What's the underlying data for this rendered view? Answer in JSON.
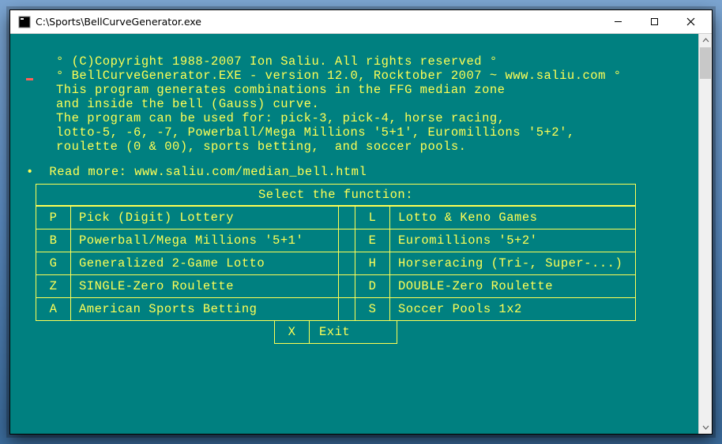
{
  "titlebar": {
    "path": "C:\\Sports\\BellCurveGenerator.exe"
  },
  "intro": {
    "line1": "° (C)Copyright 1988-2007 Ion Saliu. All rights reserved °",
    "line2": "° BellCurveGenerator.EXE - version 12.0, Rocktober 2007 ~ www.saliu.com °",
    "line3": "This program generates combinations in the FFG median zone",
    "line4": "and inside the bell (Gauss) curve.",
    "line5": "The program can be used for: pick-3, pick-4, horse racing,",
    "line6": "lotto-5, -6, -7, Powerball/Mega Millions '5+1', Euromillions '5+2',",
    "line7": "roulette (0 & 00), sports betting,  and soccer pools."
  },
  "read_more": {
    "prefix": "•  Read more: ",
    "url": "www.saliu.com/median_bell.html"
  },
  "menu": {
    "header": "Select the function:",
    "rows": [
      {
        "lk": "P",
        "ll": "Pick (Digit) Lottery",
        "rk": "L",
        "rl": "Lotto & Keno Games"
      },
      {
        "lk": "B",
        "ll": "Powerball/Mega Millions '5+1'",
        "rk": "E",
        "rl": "Euromillions '5+2'"
      },
      {
        "lk": "G",
        "ll": "Generalized 2-Game Lotto",
        "rk": "H",
        "rl": "Horseracing (Tri-, Super-...)"
      },
      {
        "lk": "Z",
        "ll": "SINGLE-Zero Roulette",
        "rk": "D",
        "rl": "DOUBLE-Zero Roulette"
      },
      {
        "lk": "A",
        "ll": "American Sports Betting",
        "rk": "S",
        "rl": "Soccer Pools 1x2"
      }
    ],
    "exit": {
      "key": "X",
      "label": "Exit"
    }
  }
}
